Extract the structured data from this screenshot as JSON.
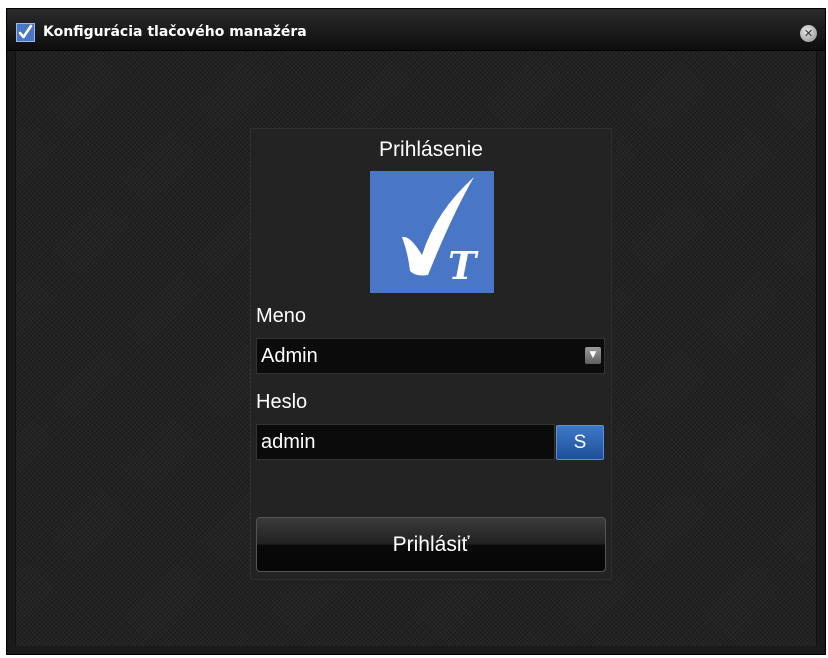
{
  "window": {
    "title": "Konfigurácia tlačového manažéra",
    "app_icon": "checkmark-t-icon",
    "close_icon": "close-icon"
  },
  "login": {
    "heading": "Prihlásenie",
    "logo_icon": "checkmark-t-logo",
    "logo_letter": "T",
    "name_label": "Meno",
    "name_value": "Admin",
    "dropdown_icon": "chevron-down-icon",
    "password_label": "Heslo",
    "password_value": "admin",
    "show_button_label": "S",
    "submit_label": "Prihlásiť"
  },
  "colors": {
    "accent_blue": "#4a76c6",
    "button_blue": "#2f63b0",
    "background": "#222222"
  }
}
